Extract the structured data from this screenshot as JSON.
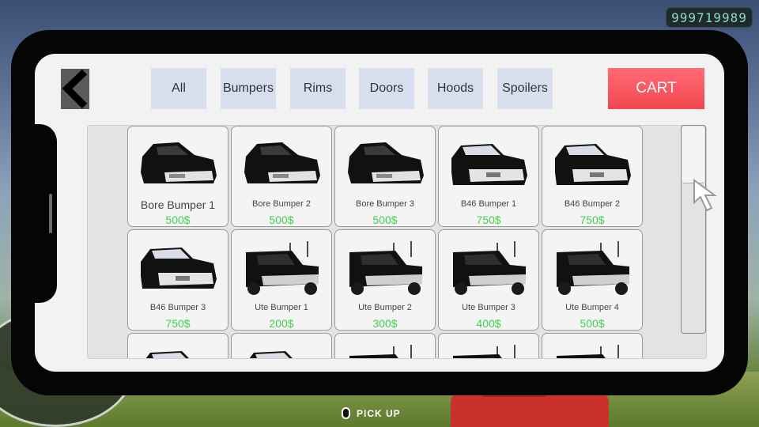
{
  "hud": {
    "money": "999719989",
    "pickup_label": "PICK UP"
  },
  "tabs": [
    {
      "label": "All"
    },
    {
      "label": "Bumpers"
    },
    {
      "label": "Rims"
    },
    {
      "label": "Doors"
    },
    {
      "label": "Hoods"
    },
    {
      "label": "Spoilers"
    }
  ],
  "cart_label": "CART",
  "colors": {
    "cart": "#f2474f",
    "tab": "#d7dfef",
    "price": "#3fd14a"
  },
  "items": [
    {
      "name": "Bore Bumper 1",
      "price": "500$",
      "style": "sedan"
    },
    {
      "name": "Bore Bumper 2",
      "price": "500$",
      "style": "sedan"
    },
    {
      "name": "Bore Bumper 3",
      "price": "500$",
      "style": "sedan"
    },
    {
      "name": "B46 Bumper 1",
      "price": "750$",
      "style": "hatch"
    },
    {
      "name": "B46 Bumper 2",
      "price": "750$",
      "style": "hatch"
    },
    {
      "name": "B46 Bumper 3",
      "price": "750$",
      "style": "hatch"
    },
    {
      "name": "Ute Bumper 1",
      "price": "200$",
      "style": "ute"
    },
    {
      "name": "Ute Bumper 2",
      "price": "300$",
      "style": "ute"
    },
    {
      "name": "Ute Bumper 3",
      "price": "400$",
      "style": "ute"
    },
    {
      "name": "Ute Bumper 4",
      "price": "500$",
      "style": "ute"
    }
  ],
  "partial_row_count": 5
}
